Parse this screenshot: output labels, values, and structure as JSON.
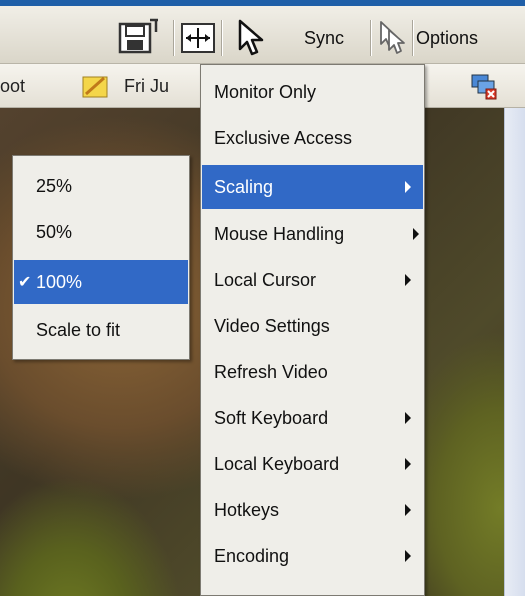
{
  "toolbar": {
    "sync_label": "Sync",
    "options_label": "Options"
  },
  "subbar": {
    "user_label": "root",
    "date_label": "Fri Ju"
  },
  "main_menu": {
    "items": [
      {
        "label": "Monitor Only"
      },
      {
        "label": "Exclusive Access"
      },
      {
        "label": "Scaling",
        "submenu": true,
        "highlighted": true
      },
      {
        "label": "Mouse Handling",
        "submenu": true
      },
      {
        "label": "Local Cursor",
        "submenu": true
      },
      {
        "label": "Video Settings"
      },
      {
        "label": "Refresh Video"
      },
      {
        "label": "Soft Keyboard",
        "submenu": true
      },
      {
        "label": "Local Keyboard",
        "submenu": true
      },
      {
        "label": "Hotkeys",
        "submenu": true
      },
      {
        "label": "Encoding",
        "submenu": true
      }
    ]
  },
  "scaling_menu": {
    "items": [
      {
        "label": "25%"
      },
      {
        "label": "50%"
      },
      {
        "label": "100%",
        "checked": true,
        "highlighted": true
      },
      {
        "label": "Scale to fit"
      }
    ]
  },
  "colors": {
    "highlight": "#3169c6",
    "menu_bg": "#efeee9"
  }
}
